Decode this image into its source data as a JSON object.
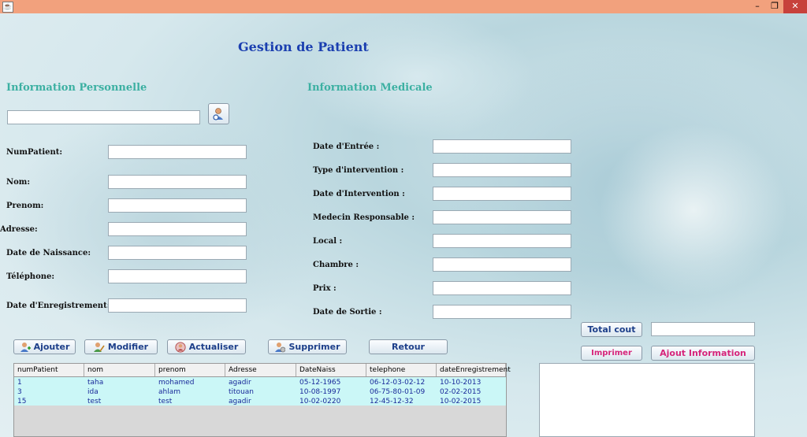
{
  "window": {
    "title_icon": "java-icon",
    "minimize_glyph": "–",
    "maximize_glyph": "❐",
    "close_glyph": "✕"
  },
  "page_title": "Gestion de Patient",
  "sections": {
    "personal": "Information Personnelle",
    "medical": "Information Medicale"
  },
  "search": {
    "value": ""
  },
  "personal_fields": [
    {
      "label": "NumPatient:",
      "value": ""
    },
    {
      "label": "Nom:",
      "value": ""
    },
    {
      "label": "Prenom:",
      "value": ""
    },
    {
      "label": "Adresse:",
      "value": ""
    },
    {
      "label": "Date de Naissance:",
      "value": ""
    },
    {
      "label": "Téléphone:",
      "value": ""
    },
    {
      "label": "Date d'Enregistrement:",
      "value": ""
    }
  ],
  "medical_fields": [
    {
      "label": "Date d'Entrée :",
      "value": ""
    },
    {
      "label": "Type d'intervention :",
      "value": ""
    },
    {
      "label": "Date d'Intervention :",
      "value": ""
    },
    {
      "label": "Medecin Responsable :",
      "value": ""
    },
    {
      "label": "Local :",
      "value": ""
    },
    {
      "label": "Chambre :",
      "value": ""
    },
    {
      "label": "Prix :",
      "value": ""
    },
    {
      "label": "Date de Sortie :",
      "value": ""
    }
  ],
  "buttons": {
    "ajouter": "Ajouter",
    "modifier": "Modifier",
    "actualiser": "Actualiser",
    "supprimer": "Supprimer",
    "retour": "Retour",
    "total_cout": "Total cout",
    "imprimer": "Imprimer",
    "ajout_information": "Ajout Information"
  },
  "total_cout_value": "",
  "colors": {
    "title": "#1b3fb0",
    "section": "#3cb0a2",
    "button_text": "#1d3f8a",
    "pink_text": "#d6247a",
    "table_rows_bg": "#cbf7f7"
  },
  "table": {
    "columns": [
      "numPatient",
      "nom",
      "prenom",
      "Adresse",
      "DateNaiss",
      "telephone",
      "dateEnregistrement"
    ],
    "rows": [
      [
        "1",
        "taha",
        "mohamed",
        "agadir",
        "05-12-1965",
        "06-12-03-02-12",
        "10-10-2013"
      ],
      [
        "3",
        "ida",
        "ahlam",
        "titouan",
        "10-08-1997",
        "06-75-80-01-09",
        "02-02-2015"
      ],
      [
        "15",
        "test",
        "test",
        "agadir",
        "10-02-0220",
        "12-45-12-32",
        "10-02-2015"
      ]
    ]
  }
}
